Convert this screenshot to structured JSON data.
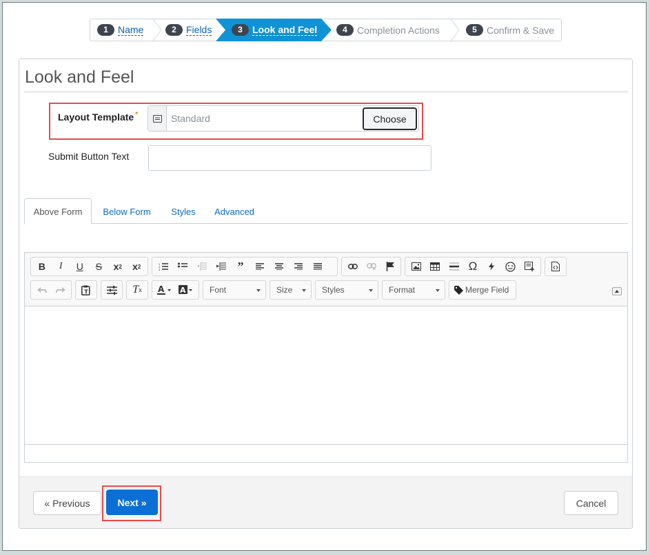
{
  "wizard": {
    "steps": [
      {
        "num": "1",
        "label": "Name"
      },
      {
        "num": "2",
        "label": "Fields"
      },
      {
        "num": "3",
        "label": "Look and Feel"
      },
      {
        "num": "4",
        "label": "Completion Actions"
      },
      {
        "num": "5",
        "label": "Confirm & Save"
      }
    ]
  },
  "page": {
    "title": "Look and Feel"
  },
  "form": {
    "layout_template": {
      "label": "Layout Template",
      "required": "*",
      "value": "Standard",
      "icon": "lookup-list-icon",
      "button": "Choose"
    },
    "submit_text": {
      "label": "Submit Button Text",
      "value": ""
    }
  },
  "tabs": [
    {
      "label": "Above Form"
    },
    {
      "label": "Below Form"
    },
    {
      "label": "Styles"
    },
    {
      "label": "Advanced"
    }
  ],
  "editor": {
    "combos": {
      "font": "Font",
      "size": "Size",
      "styles": "Styles",
      "format": "Format"
    },
    "merge_field": "Merge Field"
  },
  "footer": {
    "previous": "« Previous",
    "next": "Next »",
    "cancel": "Cancel"
  },
  "colors": {
    "brand": "#0b6fd6",
    "active_step": "#0f93d6",
    "highlight": "#e84a4a"
  }
}
